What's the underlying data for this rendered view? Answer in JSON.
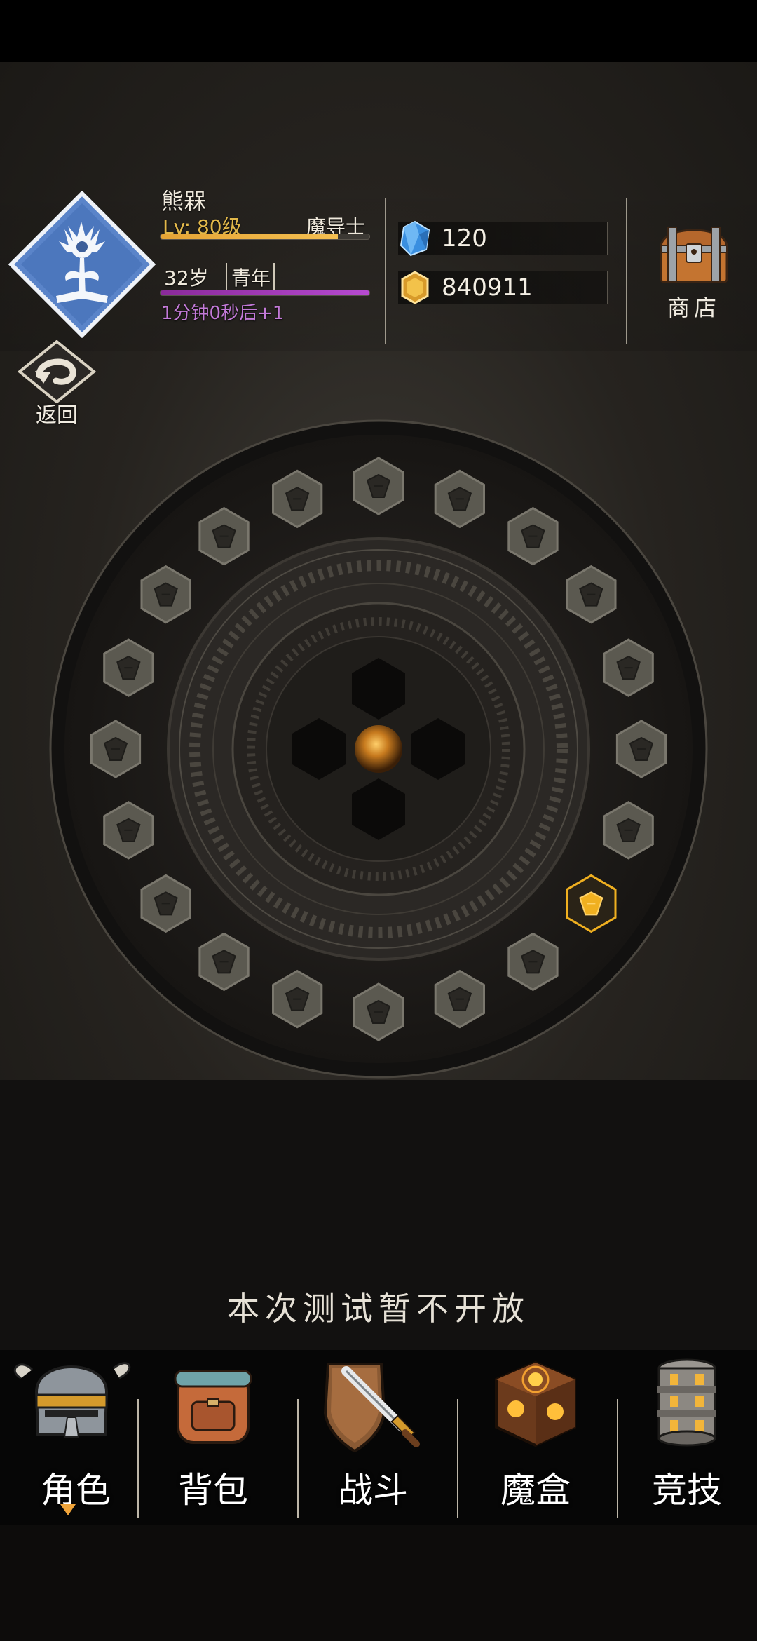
{
  "player": {
    "name": "熊槑",
    "level_label": "Lv: 80级",
    "class_name": "魔导士",
    "xp_progress": 0.85,
    "age": "32岁",
    "age_stage": "青年",
    "age_progress": 1.0,
    "timer_text": "1分钟0秒后+1"
  },
  "actions": {
    "return_label": "返回",
    "shop_label": "商店"
  },
  "resources": {
    "gems": "120",
    "gold": "840911"
  },
  "notice": "本次测试暂不开放",
  "nav": {
    "items": [
      {
        "label": "角色",
        "icon": "helmet-icon",
        "active": true
      },
      {
        "label": "背包",
        "icon": "backpack-icon",
        "active": false
      },
      {
        "label": "战斗",
        "icon": "sword-shield-icon",
        "active": false
      },
      {
        "label": "魔盒",
        "icon": "magic-box-icon",
        "active": false
      },
      {
        "label": "竞技",
        "icon": "arena-tower-icon",
        "active": false
      }
    ]
  },
  "colors": {
    "accent_orange": "#f0a43a",
    "xp": "#f3bf51",
    "age": "#b64ad0",
    "skill_active": "#f0b020"
  }
}
